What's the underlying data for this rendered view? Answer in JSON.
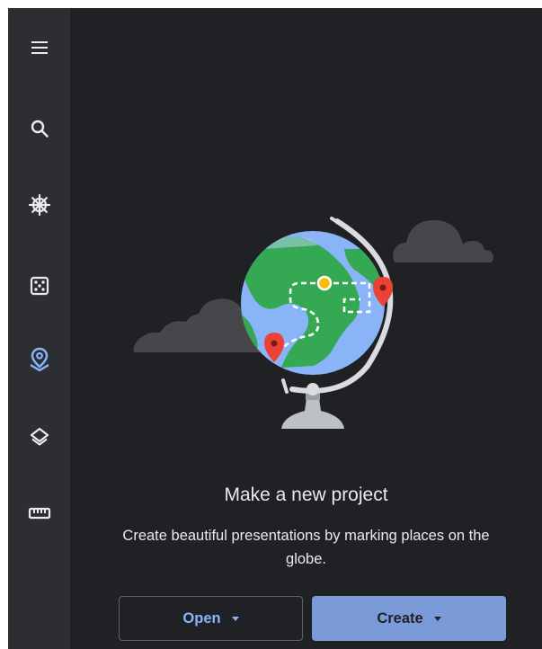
{
  "rail": {
    "items": [
      {
        "icon": "menu-icon"
      },
      {
        "icon": "search-icon"
      },
      {
        "icon": "voyager-icon"
      },
      {
        "icon": "feeling-lucky-icon"
      },
      {
        "icon": "projects-icon",
        "active": true
      },
      {
        "icon": "map-style-icon"
      },
      {
        "icon": "measure-icon"
      }
    ],
    "active_color": "#8ab4f8",
    "icon_color": "#e8eaed"
  },
  "main": {
    "title": "Make a new project",
    "subtitle": "Create beautiful presentations by marking places on the globe.",
    "open_label": "Open",
    "create_label": "Create"
  },
  "colors": {
    "background": "#202124",
    "rail": "#2d2e31",
    "primary": "#8ab4f8",
    "create_button": "#7b9bd8"
  }
}
